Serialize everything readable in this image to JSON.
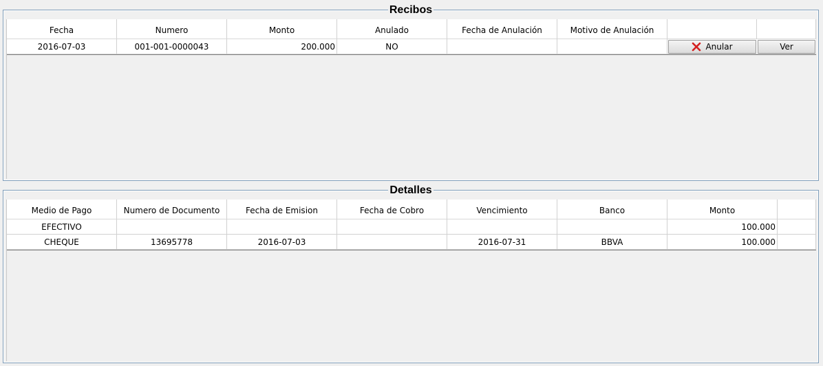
{
  "recibos": {
    "title": "Recibos",
    "columns": [
      "Fecha",
      "Numero",
      "Monto",
      "Anulado",
      "Fecha de Anulación",
      "Motivo de Anulación",
      "",
      ""
    ],
    "rows": [
      {
        "fecha": "2016-07-03",
        "numero": "001-001-0000043",
        "monto": "200.000",
        "anulado": "NO",
        "fecha_anulacion": "",
        "motivo_anulacion": "",
        "anular_label": "Anular",
        "ver_label": "Ver"
      }
    ]
  },
  "detalles": {
    "title": "Detalles",
    "columns": [
      "Medio de Pago",
      "Numero de Documento",
      "Fecha de Emision",
      "Fecha de Cobro",
      "Vencimiento",
      "Banco",
      "Monto",
      ""
    ],
    "rows": [
      {
        "medio_pago": "EFECTIVO",
        "numero_documento": "",
        "fecha_emision": "",
        "fecha_cobro": "",
        "vencimiento": "",
        "banco": "",
        "monto": "100.000"
      },
      {
        "medio_pago": "CHEQUE",
        "numero_documento": "13695778",
        "fecha_emision": "2016-07-03",
        "fecha_cobro": "",
        "vencimiento": "2016-07-31",
        "banco": "BBVA",
        "monto": "100.000"
      }
    ]
  },
  "icons": {
    "anular": "red-x-icon"
  },
  "colors": {
    "panel_border": "#7f9db9",
    "x_icon": "#d42020"
  }
}
